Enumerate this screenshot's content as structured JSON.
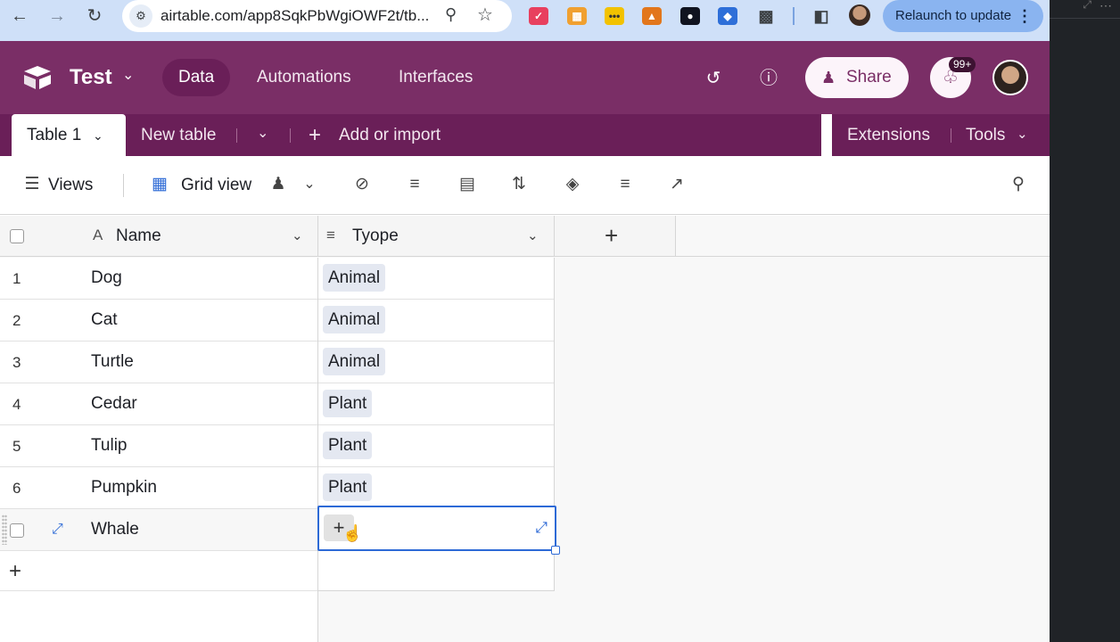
{
  "browser": {
    "url": "airtable.com/app8SqkPbWgiOWF2t/tb...",
    "relaunch_label": "Relaunch to update"
  },
  "app": {
    "base_name": "Test",
    "nav_tabs": [
      {
        "label": "Data",
        "active": true
      },
      {
        "label": "Automations",
        "active": false
      },
      {
        "label": "Interfaces",
        "active": false
      }
    ],
    "share_label": "Share",
    "notification_count": "99+",
    "accent_color": "#7a2e66"
  },
  "table_tabs": {
    "active_table": "Table 1",
    "new_table_label": "New table",
    "add_import_label": "Add or import",
    "extensions_label": "Extensions",
    "tools_label": "Tools"
  },
  "view_bar": {
    "views_label": "Views",
    "view_name": "Grid view"
  },
  "grid": {
    "columns": [
      {
        "label": "Name",
        "icon": "text-field-icon"
      },
      {
        "label": "Tyope",
        "icon": "single-select-icon"
      }
    ],
    "rows": [
      {
        "num": "1",
        "name": "Dog",
        "type": "Animal"
      },
      {
        "num": "2",
        "name": "Cat",
        "type": "Animal"
      },
      {
        "num": "3",
        "name": "Turtle",
        "type": "Animal"
      },
      {
        "num": "4",
        "name": "Cedar",
        "type": "Plant"
      },
      {
        "num": "5",
        "name": "Tulip",
        "type": "Plant"
      },
      {
        "num": "6",
        "name": "Pumpkin",
        "type": "Plant"
      },
      {
        "num": "",
        "name": "Whale",
        "type": ""
      }
    ]
  }
}
